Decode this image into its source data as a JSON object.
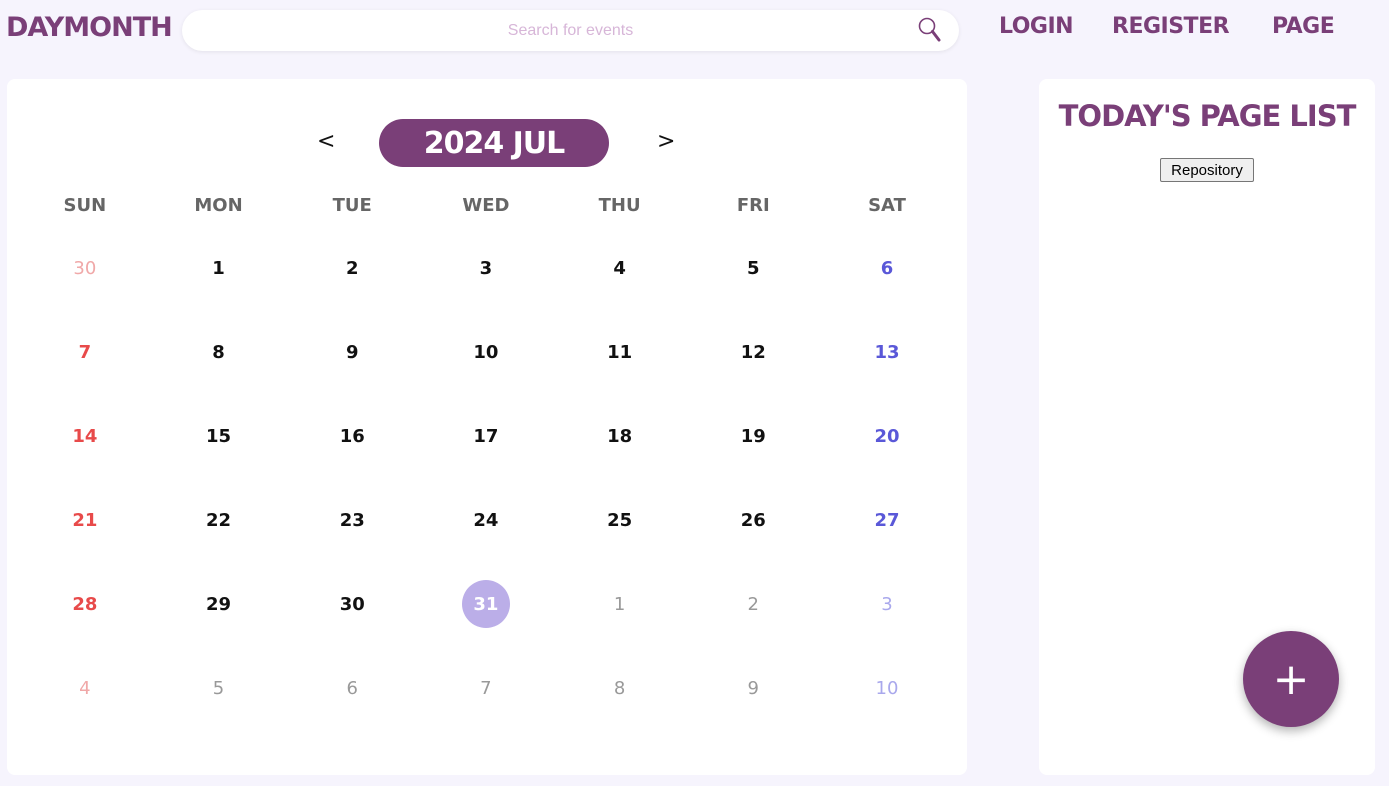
{
  "header": {
    "logo": "DAYMONTH",
    "search": {
      "placeholder": "Search for events",
      "value": ""
    },
    "nav": [
      "LOGIN",
      "REGISTER",
      "PAGE"
    ]
  },
  "calendar": {
    "prev_label": "<",
    "next_label": ">",
    "month_label": "2024 JUL",
    "weekdays": [
      "SUN",
      "MON",
      "TUE",
      "WED",
      "THU",
      "FRI",
      "SAT"
    ],
    "weeks": [
      [
        {
          "d": "30",
          "m": "prev"
        },
        {
          "d": "1"
        },
        {
          "d": "2"
        },
        {
          "d": "3"
        },
        {
          "d": "4"
        },
        {
          "d": "5"
        },
        {
          "d": "6"
        }
      ],
      [
        {
          "d": "7"
        },
        {
          "d": "8"
        },
        {
          "d": "9"
        },
        {
          "d": "10"
        },
        {
          "d": "11"
        },
        {
          "d": "12"
        },
        {
          "d": "13"
        }
      ],
      [
        {
          "d": "14"
        },
        {
          "d": "15"
        },
        {
          "d": "16"
        },
        {
          "d": "17"
        },
        {
          "d": "18"
        },
        {
          "d": "19"
        },
        {
          "d": "20"
        }
      ],
      [
        {
          "d": "21"
        },
        {
          "d": "22"
        },
        {
          "d": "23"
        },
        {
          "d": "24"
        },
        {
          "d": "25"
        },
        {
          "d": "26"
        },
        {
          "d": "27"
        }
      ],
      [
        {
          "d": "28"
        },
        {
          "d": "29"
        },
        {
          "d": "30"
        },
        {
          "d": "31",
          "today": true
        },
        {
          "d": "1",
          "m": "next"
        },
        {
          "d": "2",
          "m": "next"
        },
        {
          "d": "3",
          "m": "next"
        }
      ],
      [
        {
          "d": "4",
          "m": "next"
        },
        {
          "d": "5",
          "m": "next"
        },
        {
          "d": "6",
          "m": "next"
        },
        {
          "d": "7",
          "m": "next"
        },
        {
          "d": "8",
          "m": "next"
        },
        {
          "d": "9",
          "m": "next"
        },
        {
          "d": "10",
          "m": "next"
        }
      ]
    ]
  },
  "page_list": {
    "title": "TODAY'S PAGE LIST",
    "items": [
      "Repository"
    ]
  },
  "add_button": {
    "label": "+"
  },
  "colors": {
    "brand": "#7a3f78",
    "today_highlight": "#bbaee8",
    "sunday": "#e84a4a",
    "saturday": "#5a58d8"
  }
}
